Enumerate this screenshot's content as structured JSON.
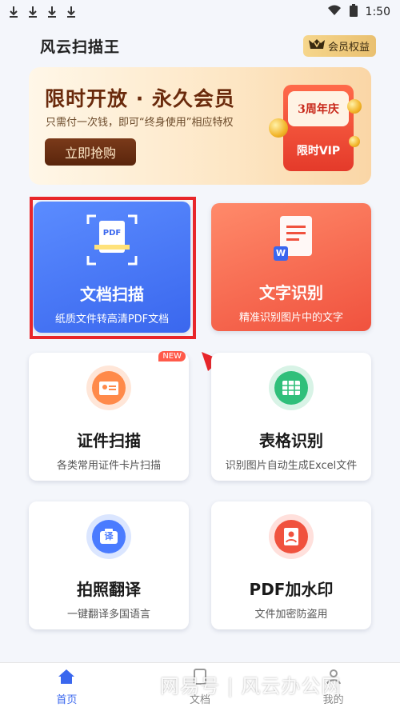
{
  "status_bar": {
    "time": "1:50"
  },
  "header": {
    "app_title": "风云扫描王",
    "vip_label": "会员权益"
  },
  "banner": {
    "title": "限时开放 · 永久会员",
    "subtitle": "只需付一次钱，即可“终身使用”相应特权",
    "button": "立即抢购",
    "card_top": "3周年庆",
    "card_bottom": "限时VIP"
  },
  "tools": [
    {
      "title": "文档扫描",
      "subtitle": "纸质文件转高清PDF文档",
      "icon_text": "PDF"
    },
    {
      "title": "文字识别",
      "subtitle": "精准识别图片中的文字",
      "icon_text": "W"
    },
    {
      "title": "证件扫描",
      "subtitle": "各类常用证件卡片扫描",
      "tag": "NEW"
    },
    {
      "title": "表格识别",
      "subtitle": "识别图片自动生成Excel文件"
    },
    {
      "title": "拍照翻译",
      "subtitle": "一键翻译多国语言",
      "icon_text": "译"
    },
    {
      "title": "PDF加水印",
      "subtitle": "文件加密防盗用"
    }
  ],
  "nav": [
    {
      "label": "首页"
    },
    {
      "label": "文档"
    },
    {
      "label": "我的"
    }
  ],
  "watermark": "网易号 | 风云办公网",
  "colors": {
    "primary": "#3a67ee",
    "red_card": "#f0523e",
    "annotation": "#e8262a"
  }
}
